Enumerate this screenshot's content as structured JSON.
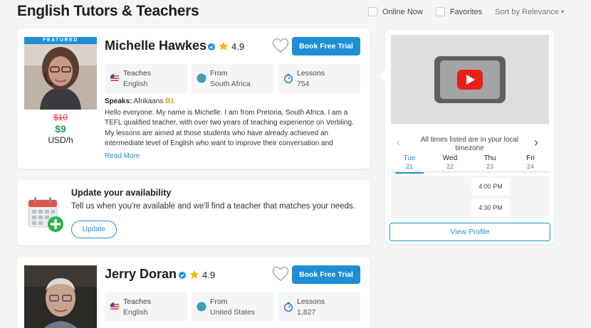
{
  "page": {
    "title": "English Tutors & Teachers"
  },
  "filters": {
    "online_now": "Online Now",
    "favorites": "Favorites",
    "sort": "Sort by Relevance"
  },
  "tutors": [
    {
      "featured": "FEATURED",
      "name": "Michelle Hawkes",
      "rating": "4.9",
      "cta": "Book Free Trial",
      "teaches_label": "Teaches",
      "teaches_value": "English",
      "from_label": "From",
      "from_value": "South Africa",
      "lessons_label": "Lessons",
      "lessons_value": "754",
      "speaks_label": "Speaks:",
      "speaks_lang": "Afrikaans",
      "speaks_level": "B1",
      "bio": "Hello everyone. My name is Michelle. I am from Pretoria, South Africa. I am a TEFL qualified teacher, with over two years of teaching experience on Verbling. My lessons are aimed at those students who have already achieved an intermediate level of English who want to improve their conversation and",
      "read_more": "Read More",
      "price_old": "$10",
      "price_new": "$9",
      "price_unit": "USD/h"
    },
    {
      "name": "Jerry Doran",
      "rating": "4.9",
      "cta": "Book Free Trial",
      "teaches_label": "Teaches",
      "teaches_value": "English",
      "from_label": "From",
      "from_value": "United States",
      "lessons_label": "Lessons",
      "lessons_value": "1,827"
    }
  ],
  "availability": {
    "title": "Update your availability",
    "text": "Tell us when you're available and we'll find a teacher that matches your needs.",
    "button": "Update"
  },
  "schedule": {
    "timezone_note": "All times listed are in your local timezone",
    "days": [
      {
        "name": "Tue",
        "num": "21"
      },
      {
        "name": "Wed",
        "num": "22"
      },
      {
        "name": "Thu",
        "num": "23"
      },
      {
        "name": "Fri",
        "num": "24"
      }
    ],
    "slots": [
      "4:00 PM",
      "4:30 PM"
    ],
    "view_profile": "View Profile"
  },
  "colors": {
    "accent": "#1e8fd6",
    "price_old": "#e03a3a",
    "price_new": "#1fa34a",
    "level": "#e0a020",
    "star": "#f5b800"
  }
}
